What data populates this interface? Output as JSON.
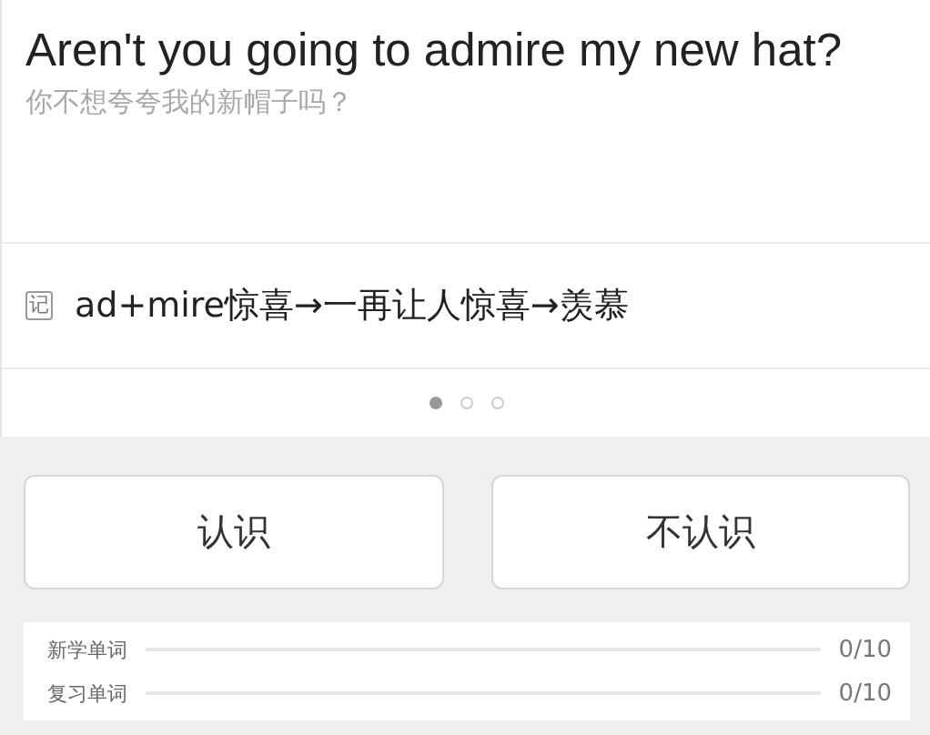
{
  "sentence": {
    "english": "Aren't you going to admire my new hat?",
    "translation": "你不想夸夸我的新帽子吗？"
  },
  "mnemonic": {
    "badge": "记",
    "text": "ad+mire惊喜→一再让人惊喜→羡慕"
  },
  "pages": [
    {
      "selected": true
    },
    {
      "selected": false
    },
    {
      "selected": false
    }
  ],
  "buttons": [
    "认识",
    "不认识"
  ],
  "progress": [
    {
      "label": "新学单词",
      "level": 0,
      "count": "0/10"
    },
    {
      "label": "复习单词",
      "level": 0,
      "count": "0/10"
    }
  ]
}
